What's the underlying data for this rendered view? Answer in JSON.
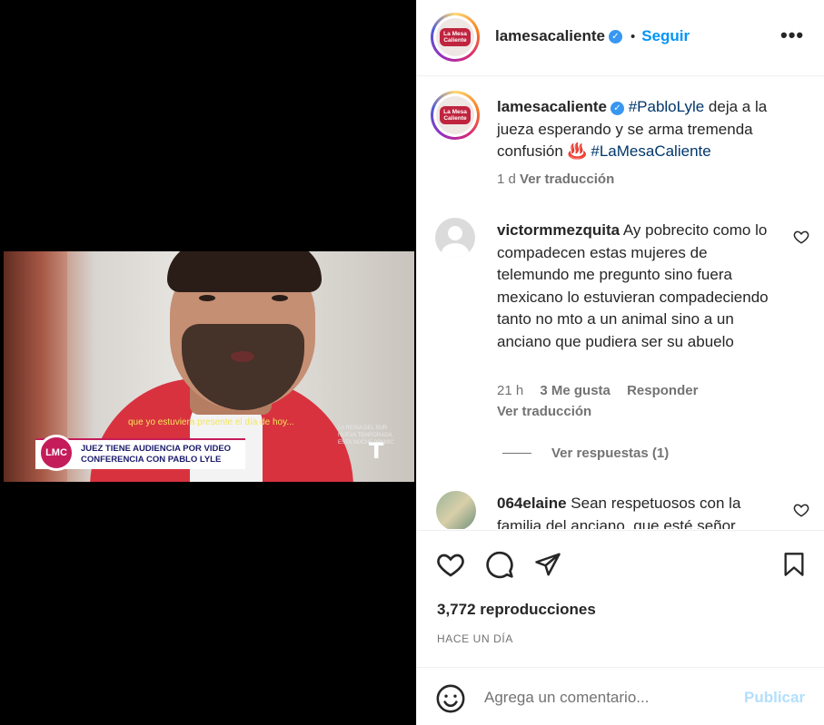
{
  "video": {
    "subtitle": "que yo estuviera presente el día de hoy...",
    "promo_text": "LA REINA DEL SUR NUEVA TEMPORADA ESTA NOCHE 9PM/8C",
    "channel_logo_name": "telemundo-logo",
    "show_badge": "LMC",
    "headline": "JUEZ TIENE AUDIENCIA POR VIDEO CONFERENCIA CON PABLO LYLE"
  },
  "header": {
    "avatar_text": "La Mesa Caliente",
    "username": "lamesacaliente",
    "separator": "•",
    "follow_label": "Seguir",
    "more_label": "•••"
  },
  "caption": {
    "username": "lamesacaliente",
    "tag1": "#PabloLyle",
    "text": " deja a la jueza esperando y se arma tremenda confusión ♨️ ",
    "tag2": "#LaMesaCaliente",
    "time": "1 d",
    "translate": "Ver traducción"
  },
  "comments": [
    {
      "username": "victormmezquita",
      "text": " Ay pobrecito como lo compadecen estas mujeres de telemundo me pregunto sino fuera mexicano lo estuvieran compadeciendo tanto no mto a un animal sino a un anciano que pudiera ser su abuelo",
      "time": "21 h",
      "likes": "3 Me gusta",
      "reply": "Responder",
      "translate": "Ver traducción",
      "view_replies": "Ver respuestas (1)"
    },
    {
      "username": "064elaine",
      "text": " Sean respetuosos con la familia del anciano, que esté señor"
    }
  ],
  "stats": {
    "views": "3,772 reproducciones",
    "posted": "HACE UN DÍA"
  },
  "composer": {
    "placeholder": "Agrega un comentario...",
    "publish_label": "Publicar"
  },
  "colors": {
    "accent": "#0095f6",
    "publish_disabled": "#b2dffc",
    "brand": "#c0243f"
  }
}
